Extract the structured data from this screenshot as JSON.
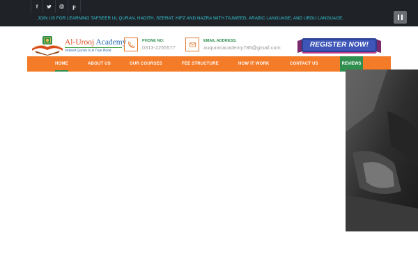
{
  "topbar": {
    "social": [
      {
        "icon": "facebook-icon",
        "glyph": "f"
      },
      {
        "icon": "twitter-icon",
        "glyph": ""
      },
      {
        "icon": "instagram-icon",
        "glyph": ""
      },
      {
        "icon": "pinterest-icon",
        "glyph": "p"
      }
    ],
    "ticker": "JOIN US FOR LEARNING TAFSEER UL QURAN, HADITH, SEERAT, HIFZ AND NAZRA WITH TAJWEED, ARABIC LANGUAGE, AND URDU LANGUAGE.",
    "pause_icon": "pause-icon"
  },
  "header": {
    "logo_title_part1": "Al-Urooj",
    "logo_title_part2": " Academy",
    "logo_tagline": "Indeed Quran Is A True Book",
    "phone_label": "PHONE NO:",
    "phone_value": "0313-2255577",
    "email_label": "EMAIL ADDRESS:",
    "email_value": "auquranacademy786@gmail.com",
    "register_label": "REGISTER NOW!"
  },
  "nav": {
    "items": [
      "HOME",
      "ABOUT US",
      "OUR COURSES",
      "FEE STRUCTURE",
      "HOW IT WORK",
      "CONTACT US"
    ],
    "reviews": "REVIEWS",
    "active": "HOME"
  },
  "colors": {
    "topbar": "#1f2328",
    "ticker": "#34c6d6",
    "nav": "#f47b28",
    "nav_accent": "#2f8f4f",
    "brand_orange": "#d9481c",
    "brand_blue": "#2f6db5"
  }
}
